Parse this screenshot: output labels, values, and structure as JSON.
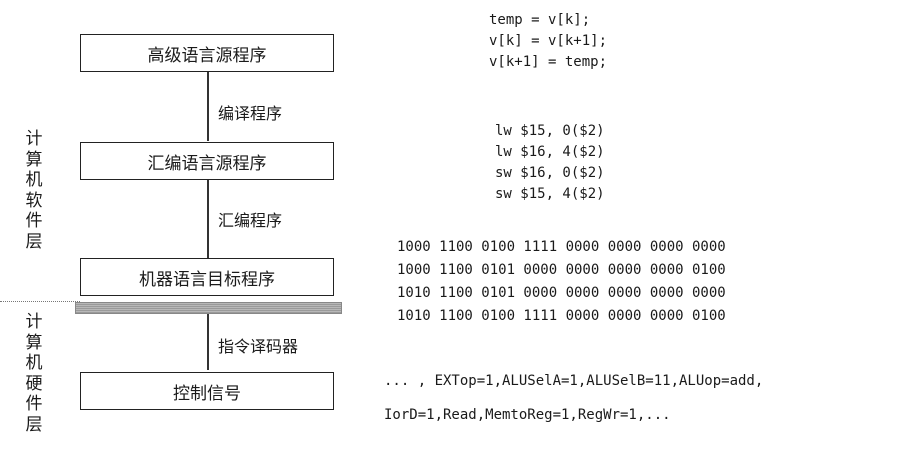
{
  "side_labels": {
    "software": [
      "计",
      "算",
      "机",
      "软",
      "件",
      "层"
    ],
    "hardware": [
      "计",
      "算",
      "机",
      "硬",
      "件",
      "层"
    ]
  },
  "boxes": {
    "high_level": "高级语言源程序",
    "assembly": "汇编语言源程序",
    "machine": "机器语言目标程序",
    "control": "控制信号"
  },
  "arrows": {
    "compiler": "编译程序",
    "assembler": "汇编程序",
    "decoder": "指令译码器"
  },
  "code": {
    "high_level": [
      "temp = v[k];",
      "v[k] = v[k+1];",
      "v[k+1] = temp;"
    ],
    "assembly": [
      "lw $15, 0($2)",
      "lw $16, 4($2)",
      "sw $16, 0($2)",
      "sw $15, 4($2)"
    ],
    "machine": [
      "1000 1100 0100 1111 0000 0000 0000 0000",
      "1000 1100 0101 0000 0000 0000 0000 0100",
      "1010 1100 0101 0000 0000 0000 0000 0000",
      "1010 1100 0100 1111 0000 0000 0000 0100"
    ],
    "control": [
      "... , EXTop=1,ALUSelA=1,ALUSelB=11,ALUop=add,",
      "IorD=1,Read,MemtoReg=1,RegWr=1,..."
    ]
  }
}
